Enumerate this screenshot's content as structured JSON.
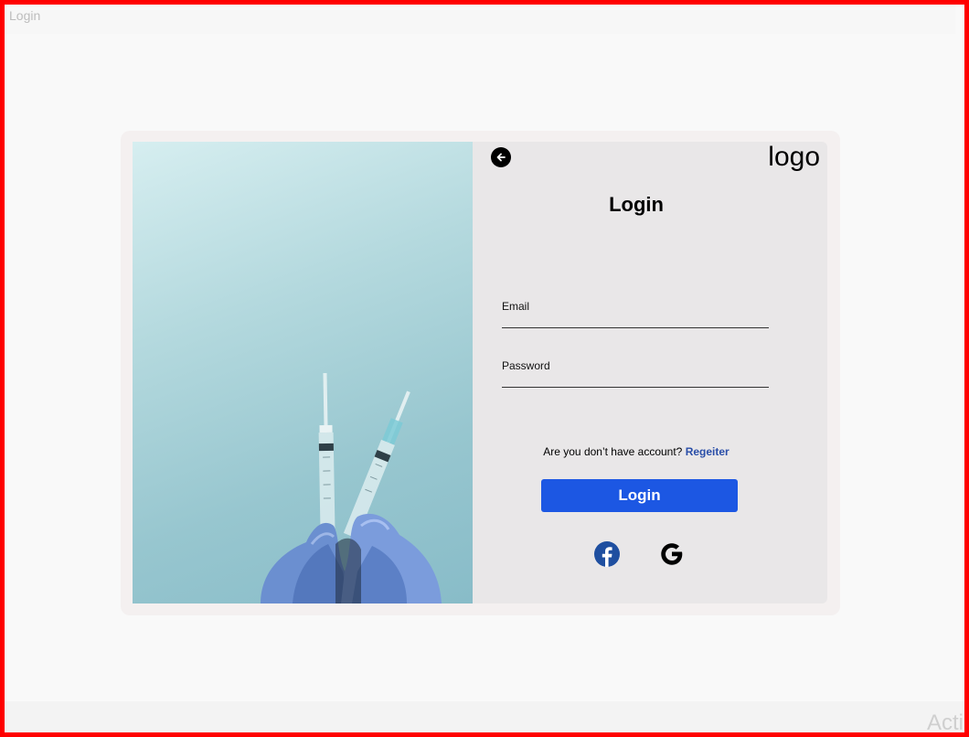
{
  "window": {
    "label": "Login"
  },
  "panel": {
    "logo": "logo",
    "title": "Login",
    "email": {
      "label": "Email",
      "value": "",
      "placeholder": ""
    },
    "password": {
      "label": "Password",
      "value": "",
      "placeholder": ""
    },
    "register": {
      "prompt": "Are you don’t have account?",
      "link": "Regeiter"
    },
    "login_button": "Login",
    "social": [
      "facebook-icon",
      "google-icon"
    ]
  },
  "watermark": "Acti",
  "colors": {
    "accent": "#1c57e3",
    "link": "#2a4ea8",
    "facebook": "#1f4fa0",
    "frame_border": "#ff0000"
  }
}
